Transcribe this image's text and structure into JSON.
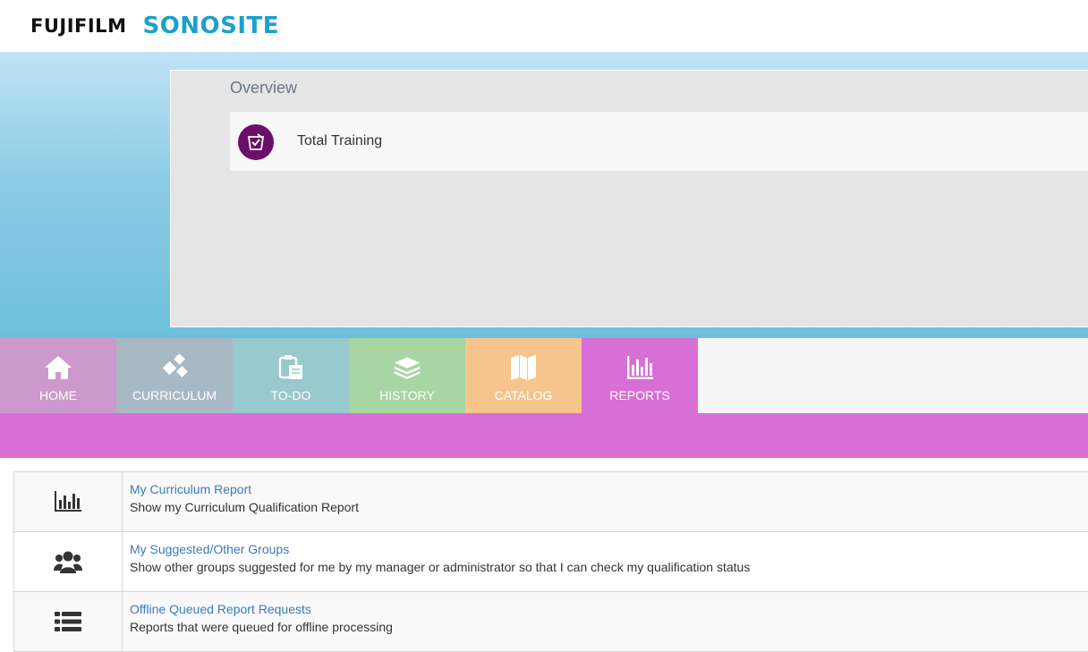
{
  "header": {
    "logo_brand": "FUJIFILM",
    "logo_product": "SONOSITE"
  },
  "overview": {
    "title": "Overview",
    "total_training_label": "Total Training"
  },
  "tabs": [
    {
      "label": "HOME",
      "icon": "home-icon",
      "color": "#cc99cc"
    },
    {
      "label": "CURRICULUM",
      "icon": "cubes-icon",
      "color": "#a9b8c5"
    },
    {
      "label": "TO-DO",
      "icon": "clipboard-icon",
      "color": "#97c9cf"
    },
    {
      "label": "HISTORY",
      "icon": "layers-icon",
      "color": "#a8d5a4"
    },
    {
      "label": "CATALOG",
      "icon": "map-icon",
      "color": "#f6c58e"
    },
    {
      "label": "REPORTS",
      "icon": "bar-chart-icon",
      "color": "#d76fd6"
    }
  ],
  "reports": [
    {
      "title": "My Curriculum Report",
      "description": "Show my Curriculum Qualification Report",
      "icon": "bar-chart-icon"
    },
    {
      "title": "My Suggested/Other Groups",
      "description": "Show other groups suggested for me by my manager or administrator so that I can check my qualification status",
      "icon": "users-icon"
    },
    {
      "title": "Offline Queued Report Requests",
      "description": "Reports that were queued for offline processing",
      "icon": "list-icon"
    }
  ]
}
